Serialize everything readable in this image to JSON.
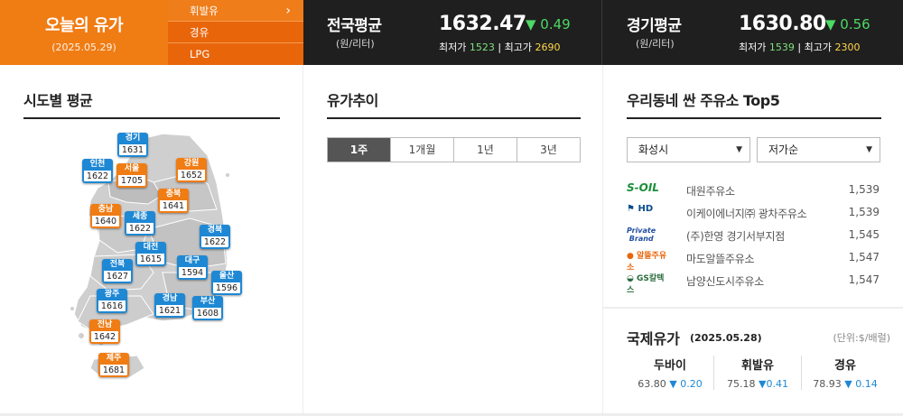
{
  "header": {
    "title": "오늘의 유가",
    "date": "(2025.05.29)",
    "fuel_tabs": [
      "휘발유",
      "경유",
      "LPG"
    ],
    "national": {
      "name": "전국평균",
      "unit": "(원/리터)",
      "price": "1632.47",
      "change": "▼ 0.49",
      "min_label": "최저가",
      "min": "1523",
      "max_label": "최고가",
      "max": "2690"
    },
    "region": {
      "name": "경기평균",
      "unit": "(원/리터)",
      "price": "1630.80",
      "change": "▼ 0.56",
      "min_label": "최저가",
      "min": "1539",
      "max_label": "최고가",
      "max": "2300"
    }
  },
  "regional": {
    "title": "시도별 평균",
    "regions": [
      {
        "name": "경기",
        "value": "1631"
      },
      {
        "name": "인천",
        "value": "1622"
      },
      {
        "name": "서울",
        "value": "1705"
      },
      {
        "name": "강원",
        "value": "1652"
      },
      {
        "name": "충북",
        "value": "1641"
      },
      {
        "name": "충남",
        "value": "1640"
      },
      {
        "name": "세종",
        "value": "1622"
      },
      {
        "name": "경북",
        "value": "1622"
      },
      {
        "name": "대전",
        "value": "1615"
      },
      {
        "name": "전북",
        "value": "1627"
      },
      {
        "name": "대구",
        "value": "1594"
      },
      {
        "name": "울산",
        "value": "1596"
      },
      {
        "name": "광주",
        "value": "1616"
      },
      {
        "name": "경남",
        "value": "1621"
      },
      {
        "name": "부산",
        "value": "1608"
      },
      {
        "name": "전남",
        "value": "1642"
      },
      {
        "name": "제주",
        "value": "1681"
      }
    ],
    "colors": {
      "blue": "#1e88d4",
      "orange": "#f07c14"
    }
  },
  "trend": {
    "title": "유가추이",
    "tabs": [
      "1주",
      "1개월",
      "1년",
      "3년"
    ]
  },
  "top5": {
    "title": "우리동네 싼 주유소 Top5",
    "region_select": "화성시",
    "sort_select": "저가순",
    "stations": [
      {
        "brand": "S-OIL",
        "name": "대원주유소",
        "price": "1,539"
      },
      {
        "brand": "HD HYUNDAI OILBANK",
        "name": "이케이에너지㈜ 광차주유소",
        "price": "1,539"
      },
      {
        "brand": "Private Brand",
        "name": "(주)한영 경기서부지점",
        "price": "1,545"
      },
      {
        "brand": "알뜰주유소",
        "name": "마도알뜰주유소",
        "price": "1,547"
      },
      {
        "brand": "GS칼텍스",
        "name": "남양신도시주유소",
        "price": "1,547"
      }
    ]
  },
  "international": {
    "title": "국제유가",
    "date": "(2025.05.28)",
    "unit": "(단위:$/배럴)",
    "items": [
      {
        "name": "두바이",
        "value": "63.80",
        "change": "▼ 0.20"
      },
      {
        "name": "휘발유",
        "value": "75.18",
        "change": "▼0.41"
      },
      {
        "name": "경유",
        "value": "78.93",
        "change": "▼ 0.14"
      }
    ]
  }
}
